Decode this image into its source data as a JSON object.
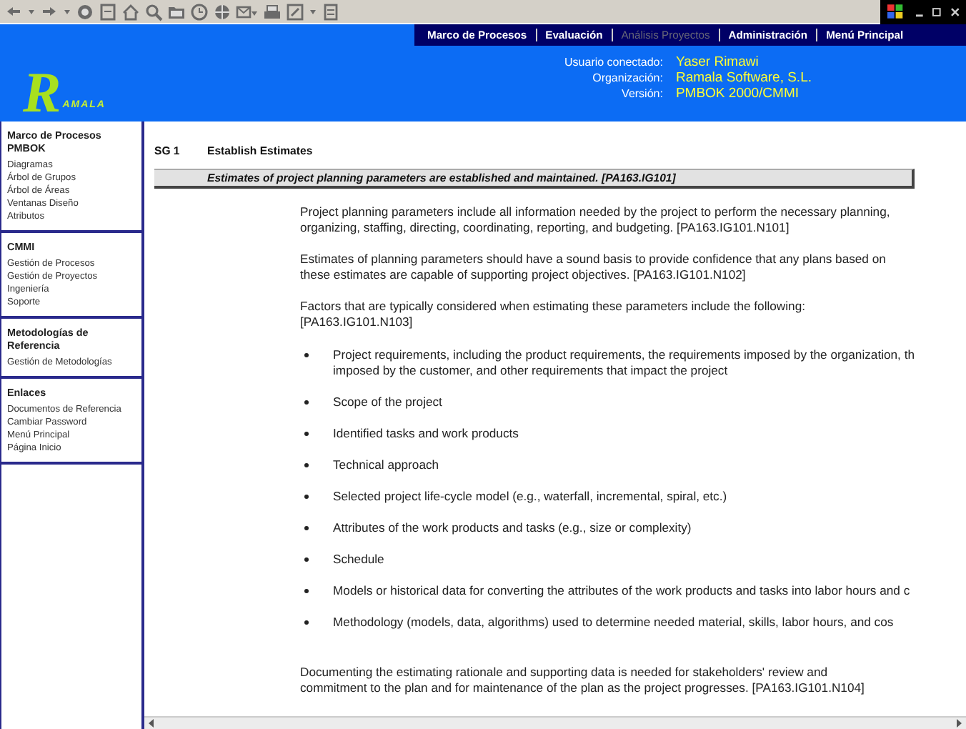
{
  "logo": {
    "initial": "R",
    "rest": "AMALA"
  },
  "nav": [
    {
      "label": "Marco de Procesos",
      "disabled": false
    },
    {
      "label": "Evaluación",
      "disabled": false
    },
    {
      "label": "Análisis Proyectos",
      "disabled": true
    },
    {
      "label": "Administración",
      "disabled": false
    },
    {
      "label": "Menú Principal",
      "disabled": false
    }
  ],
  "session": [
    {
      "label": "Usuario conectado:",
      "value": "Yaser Rimawi"
    },
    {
      "label": "Organización:",
      "value": "Ramala Software, S.L."
    },
    {
      "label": "Versión:",
      "value": "PMBOK 2000/CMMI"
    }
  ],
  "sidebar": [
    {
      "title": "Marco de Procesos PMBOK",
      "items": [
        "Diagramas",
        "Árbol de Grupos",
        "Árbol de Áreas",
        "Ventanas Diseño",
        "Atributos"
      ]
    },
    {
      "title": "CMMI",
      "items": [
        "Gestión de Procesos",
        "Gestión de Proyectos",
        "Ingeniería",
        "Soporte"
      ]
    },
    {
      "title": "Metodologías de Referencia",
      "items": [
        "Gestión de Metodologías"
      ]
    },
    {
      "title": "Enlaces",
      "items": [
        "Documentos de Referencia",
        "Cambiar Password",
        "Menú Principal",
        "Página Inicio"
      ]
    }
  ],
  "content": {
    "goal_id": "SG 1",
    "goal_title": "Establish Estimates",
    "goal_statement": "Estimates of project planning parameters are established and maintained. [PA163.IG101]",
    "paragraphs": [
      [
        "Project planning parameters include all information needed by the project to perform the necessary planning,",
        "organizing, staffing, directing, coordinating, reporting, and budgeting. [PA163.IG101.N101]"
      ],
      [
        "Estimates of planning parameters should have a sound basis to provide confidence that any plans based on",
        "these estimates are capable of supporting project objectives. [PA163.IG101.N102]"
      ],
      [
        "Factors that are typically considered when estimating these parameters include the following:",
        "[PA163.IG101.N103]"
      ]
    ],
    "bullets": [
      [
        "Project requirements, including the product requirements, the requirements imposed by the organization, th",
        "imposed by the customer, and other requirements that impact the project"
      ],
      [
        "Scope of the project"
      ],
      [
        "Identified tasks and work products"
      ],
      [
        "Technical approach"
      ],
      [
        "Selected project life-cycle model (e.g., waterfall, incremental, spiral, etc.)"
      ],
      [
        "Attributes of the work products and tasks (e.g., size or complexity)"
      ],
      [
        "Schedule"
      ],
      [
        "Models or historical data for converting the attributes of the work products and tasks into labor hours and c"
      ],
      [
        "Methodology (models, data, algorithms) used to determine needed material, skills, labor hours, and cos"
      ]
    ],
    "closing": [
      "Documenting the estimating rationale and supporting data is needed for stakeholders' review and",
      "commitment to the plan and for maintenance of the plan as the project progresses. [PA163.IG101.N104]"
    ]
  }
}
